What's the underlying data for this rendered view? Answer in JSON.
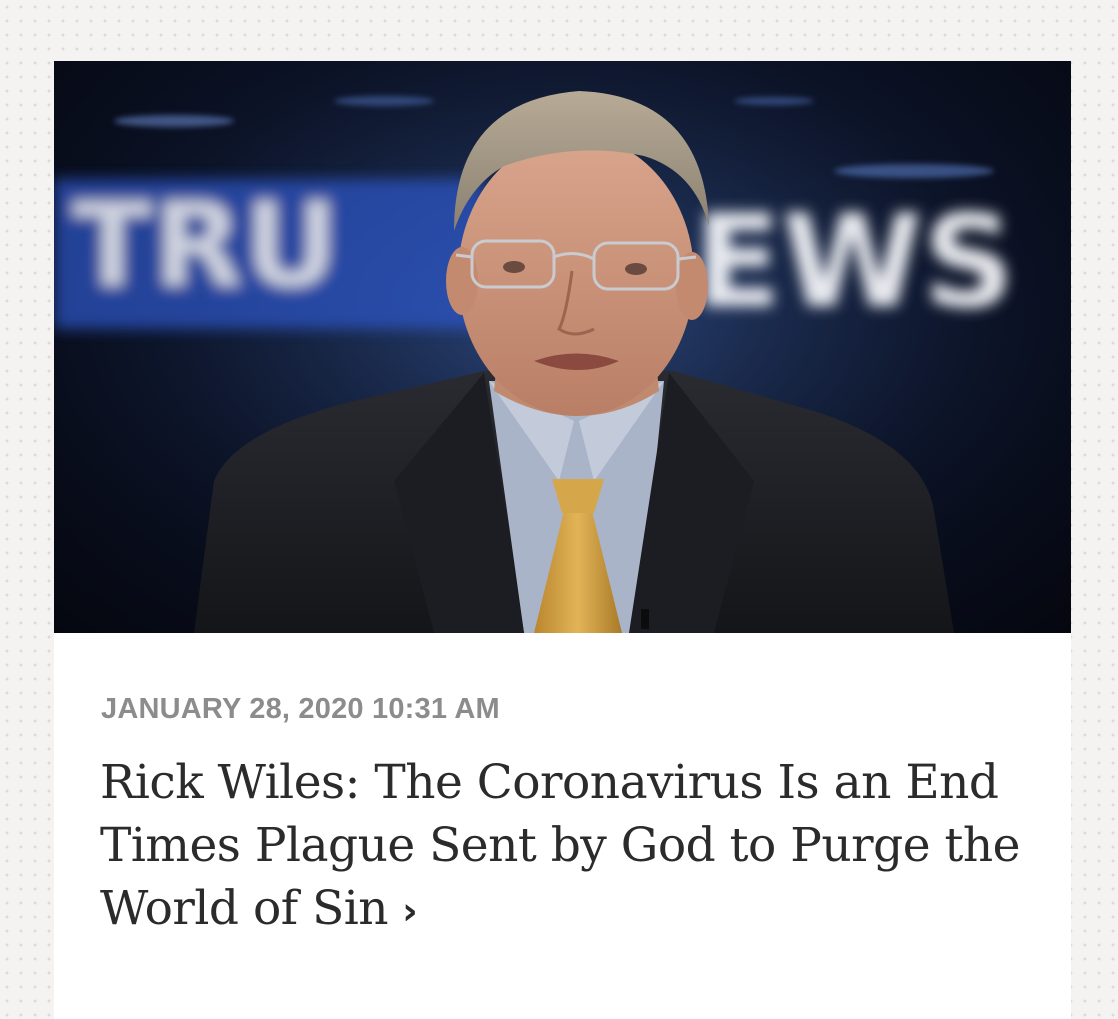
{
  "article": {
    "image": {
      "alt": "News anchor seated at desk in front of a blurred TRUNEWS logo",
      "logo_left": "TRU",
      "logo_right": "EWS"
    },
    "timestamp": "JANUARY 28, 2020 10:31 AM",
    "headline": "Rick Wiles: The Coronavirus Is an End Times Plague Sent by God to Purge the World of Sin",
    "link_chevron": "›"
  },
  "colors": {
    "page_bg": "#f4f3f2",
    "card_bg": "#ffffff",
    "timestamp": "#8c8c8c",
    "headline": "#2b2b2b"
  }
}
